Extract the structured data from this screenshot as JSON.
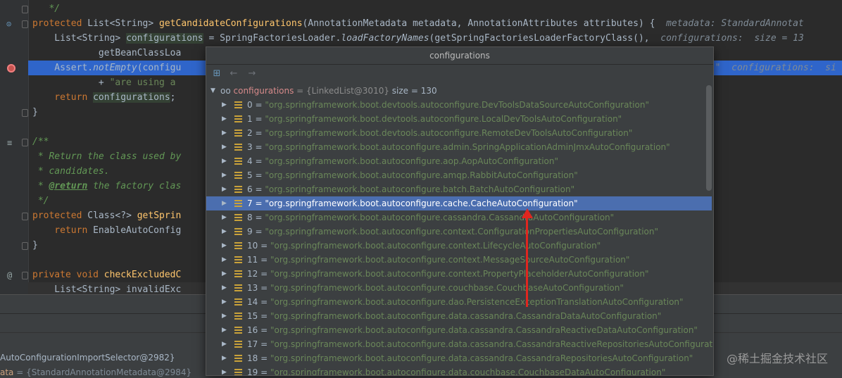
{
  "editor": {
    "lines": [
      {
        "tokens": [
          {
            "c": "cm",
            "t": "   */"
          }
        ]
      },
      {
        "tokens": [
          {
            "c": "kw",
            "t": "protected "
          },
          {
            "c": "",
            "t": "List<String> "
          },
          {
            "c": "fn",
            "t": "getCandidateConfigurations"
          },
          {
            "c": "",
            "t": "(AnnotationMetadata metadata, AnnotationAttributes attributes) {  "
          },
          {
            "c": "hint",
            "t": "metadata: StandardAnnotat"
          }
        ]
      },
      {
        "tokens": [
          {
            "c": "",
            "t": "    List<String> "
          },
          {
            "c": "hlbox",
            "t": "configurations"
          },
          {
            "c": "",
            "t": " = SpringFactoriesLoader."
          },
          {
            "c": "it",
            "t": "loadFactoryNames"
          },
          {
            "c": "",
            "t": "(getSpringFactoriesLoaderFactoryClass(),  "
          },
          {
            "c": "hint",
            "t": "configurations:  size = 13"
          }
        ]
      },
      {
        "tokens": [
          {
            "c": "",
            "t": "            getBeanClassLoa"
          }
        ]
      },
      {
        "tokens": [
          {
            "c": "",
            "t": "    Assert."
          },
          {
            "c": "it",
            "t": "notEmpty"
          },
          {
            "c": "",
            "t": "(configu"
          }
        ],
        "right": [
          {
            "c": "hint",
            "t": "o \"  configurations:  si"
          }
        ]
      },
      {
        "tokens": [
          {
            "c": "",
            "t": "            + "
          },
          {
            "c": "str",
            "t": "\"are using a"
          }
        ]
      },
      {
        "tokens": [
          {
            "c": "kw",
            "t": "    return "
          },
          {
            "c": "hlbox",
            "t": "configurations"
          },
          {
            "c": "",
            "t": ";"
          }
        ]
      },
      {
        "tokens": [
          {
            "c": "",
            "t": "}"
          }
        ]
      },
      {
        "tokens": [
          {
            "c": "",
            "t": ""
          }
        ]
      },
      {
        "tokens": [
          {
            "c": "cm",
            "t": "/**"
          }
        ]
      },
      {
        "tokens": [
          {
            "c": "cm",
            "t": " * Return the class used by"
          }
        ]
      },
      {
        "tokens": [
          {
            "c": "cm",
            "t": " * candidates."
          }
        ]
      },
      {
        "tokens": [
          {
            "c": "cm",
            "t": " * "
          },
          {
            "c": "cmtag",
            "t": "@return"
          },
          {
            "c": "cm",
            "t": " the factory clas"
          }
        ]
      },
      {
        "tokens": [
          {
            "c": "cm",
            "t": " */"
          }
        ]
      },
      {
        "tokens": [
          {
            "c": "kw",
            "t": "protected "
          },
          {
            "c": "",
            "t": "Class<?> "
          },
          {
            "c": "fn",
            "t": "getSprin"
          }
        ]
      },
      {
        "tokens": [
          {
            "c": "kw",
            "t": "    return "
          },
          {
            "c": "",
            "t": "EnableAutoConfig"
          }
        ]
      },
      {
        "tokens": [
          {
            "c": "",
            "t": "}"
          }
        ]
      },
      {
        "tokens": [
          {
            "c": "",
            "t": ""
          }
        ]
      },
      {
        "tokens": [
          {
            "c": "kw",
            "t": "private void "
          },
          {
            "c": "fn",
            "t": "checkExcludedC"
          }
        ]
      },
      {
        "tokens": [
          {
            "c": "",
            "t": "    List<String> invalidExc"
          }
        ]
      }
    ]
  },
  "debug": {
    "frame1": "AutoConfigurationImportSelector@2982}",
    "frame2_key": "ata",
    "frame2_val": " = {StandardAnnotationMetadata@2984}"
  },
  "popup": {
    "title": "configurations",
    "root_name": "configurations",
    "root_type": " = {LinkedList@3010}",
    "root_size": "  size = 130",
    "items": [
      {
        "i": "0",
        "v": "\"org.springframework.boot.devtools.autoconfigure.DevToolsDataSourceAutoConfiguration\""
      },
      {
        "i": "1",
        "v": "\"org.springframework.boot.devtools.autoconfigure.LocalDevToolsAutoConfiguration\""
      },
      {
        "i": "2",
        "v": "\"org.springframework.boot.devtools.autoconfigure.RemoteDevToolsAutoConfiguration\""
      },
      {
        "i": "3",
        "v": "\"org.springframework.boot.autoconfigure.admin.SpringApplicationAdminJmxAutoConfiguration\""
      },
      {
        "i": "4",
        "v": "\"org.springframework.boot.autoconfigure.aop.AopAutoConfiguration\""
      },
      {
        "i": "5",
        "v": "\"org.springframework.boot.autoconfigure.amqp.RabbitAutoConfiguration\""
      },
      {
        "i": "6",
        "v": "\"org.springframework.boot.autoconfigure.batch.BatchAutoConfiguration\""
      },
      {
        "i": "7",
        "v": "\"org.springframework.boot.autoconfigure.cache.CacheAutoConfiguration\""
      },
      {
        "i": "8",
        "v": "\"org.springframework.boot.autoconfigure.cassandra.CassandraAutoConfiguration\""
      },
      {
        "i": "9",
        "v": "\"org.springframework.boot.autoconfigure.context.ConfigurationPropertiesAutoConfiguration\""
      },
      {
        "i": "10",
        "v": "\"org.springframework.boot.autoconfigure.context.LifecycleAutoConfiguration\""
      },
      {
        "i": "11",
        "v": "\"org.springframework.boot.autoconfigure.context.MessageSourceAutoConfiguration\""
      },
      {
        "i": "12",
        "v": "\"org.springframework.boot.autoconfigure.context.PropertyPlaceholderAutoConfiguration\""
      },
      {
        "i": "13",
        "v": "\"org.springframework.boot.autoconfigure.couchbase.CouchbaseAutoConfiguration\""
      },
      {
        "i": "14",
        "v": "\"org.springframework.boot.autoconfigure.dao.PersistenceExceptionTranslationAutoConfiguration\""
      },
      {
        "i": "15",
        "v": "\"org.springframework.boot.autoconfigure.data.cassandra.CassandraDataAutoConfiguration\""
      },
      {
        "i": "16",
        "v": "\"org.springframework.boot.autoconfigure.data.cassandra.CassandraReactiveDataAutoConfiguration\""
      },
      {
        "i": "17",
        "v": "\"org.springframework.boot.autoconfigure.data.cassandra.CassandraReactiveRepositoriesAutoConfiguration\""
      },
      {
        "i": "18",
        "v": "\"org.springframework.boot.autoconfigure.data.cassandra.CassandraRepositoriesAutoConfiguration\""
      },
      {
        "i": "19",
        "v": "\"org.springframework.boot.autoconfigure.data.couchbase.CouchbaseDataAutoConfiguration\""
      }
    ],
    "selected_index": 7
  },
  "watermark": "@稀土掘金技术社区",
  "colors": {
    "selection": "#4b6eaf",
    "annotation_arrow": "#e0261f",
    "breakpoint": "#c75450"
  }
}
